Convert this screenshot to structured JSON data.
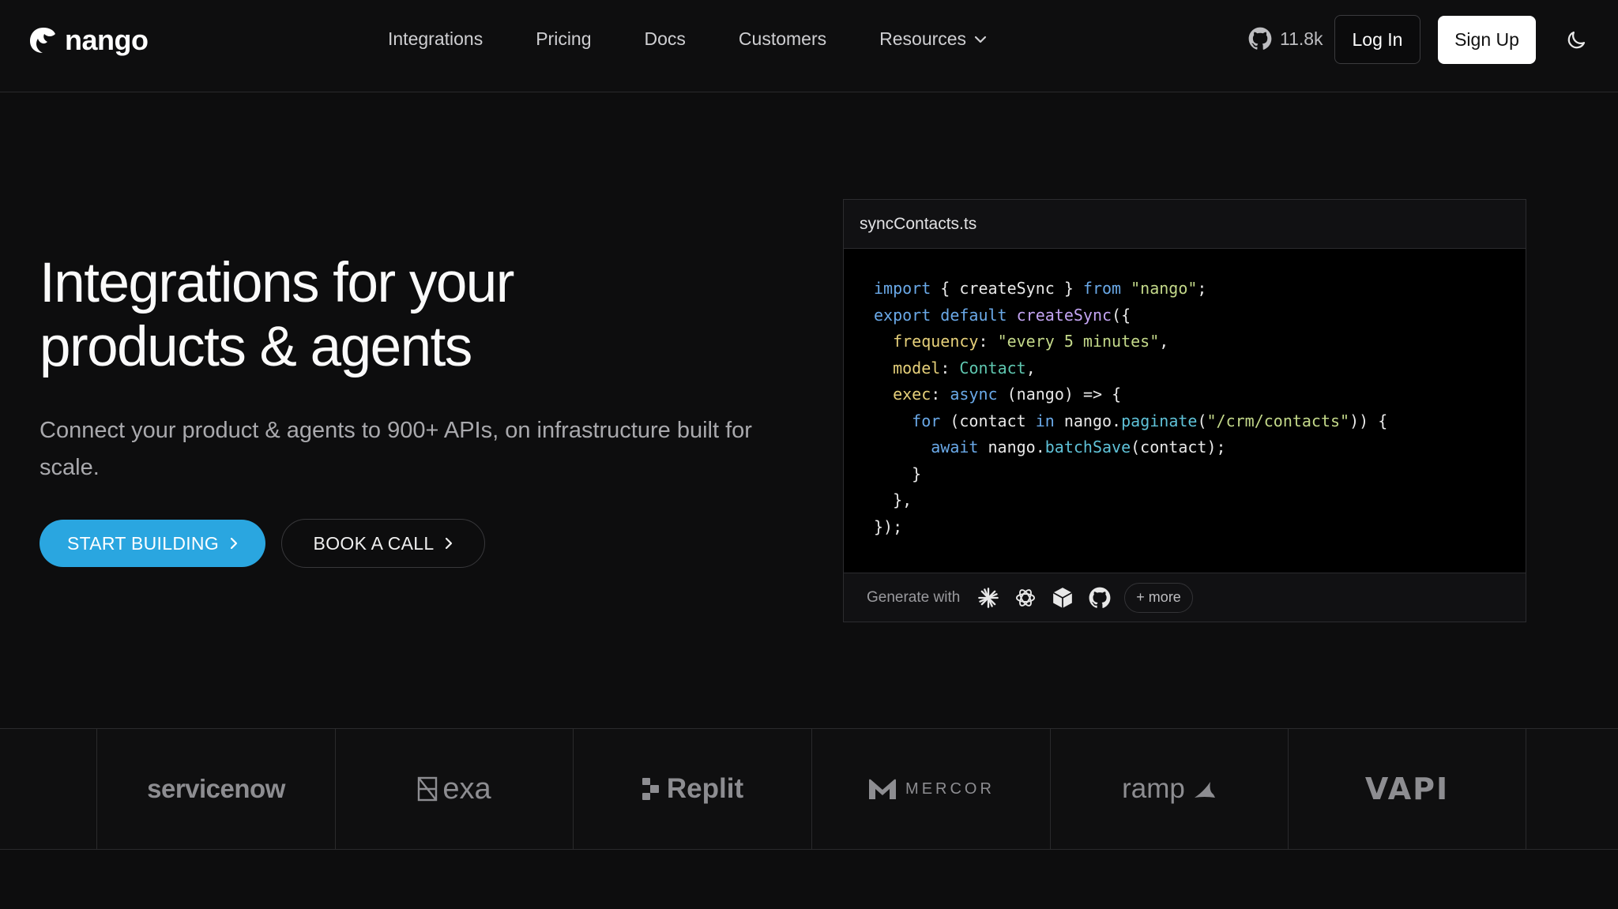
{
  "nav": {
    "logo_text": "nango",
    "links": [
      {
        "label": "Integrations"
      },
      {
        "label": "Pricing"
      },
      {
        "label": "Docs"
      },
      {
        "label": "Customers"
      },
      {
        "label": "Resources"
      }
    ],
    "github_stars": "11.8k",
    "login_label": "Log In",
    "signup_label": "Sign Up"
  },
  "hero": {
    "title_line1": "Integrations for your",
    "title_line2": "products & agents",
    "subtitle": "Connect your product & agents to 900+ APIs, on infrastructure built for scale.",
    "primary_cta": "START BUILDING",
    "secondary_cta": "BOOK A CALL"
  },
  "code": {
    "filename": "syncContacts.ts",
    "generate_label": "Generate with",
    "more_label": "+ more",
    "generator_icons": [
      "claude-icon",
      "openai-icon",
      "cursor-icon",
      "github-icon"
    ]
  },
  "customers": [
    "servicenow",
    "exa",
    "Replit",
    "MERCOR",
    "ramp",
    "VAPI"
  ],
  "colors": {
    "background": "#0d0d0e",
    "accent": "#2aa6e0",
    "text_muted": "#a9a9ad"
  }
}
